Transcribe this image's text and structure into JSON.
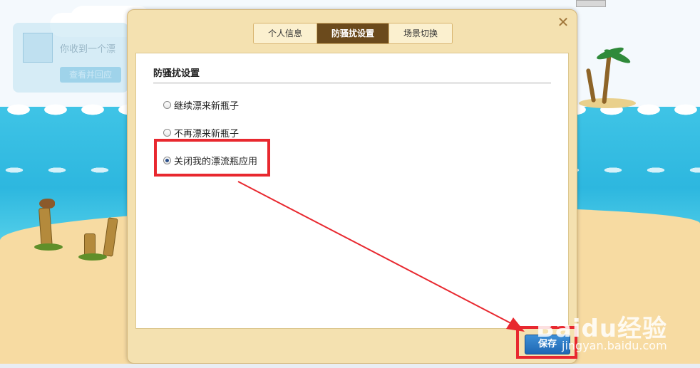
{
  "background": {
    "user_card": {
      "text": "你收到一个漂",
      "button_label": "查看并回应"
    }
  },
  "dialog": {
    "close_symbol": "✕",
    "tabs": [
      {
        "label": "个人信息",
        "active": false
      },
      {
        "label": "防骚扰设置",
        "active": true
      },
      {
        "label": "场景切换",
        "active": false
      }
    ],
    "section_title": "防骚扰设置",
    "options": [
      {
        "label": "继续漂来新瓶子",
        "checked": false
      },
      {
        "label": "不再漂来新瓶子",
        "checked": false
      },
      {
        "label": "关闭我的漂流瓶应用",
        "checked": true
      }
    ],
    "save_label": "保存"
  },
  "watermark": {
    "logo": "Baidu经验",
    "url": "jingyan.baidu.com"
  },
  "colors": {
    "accent": "#6b4a1c",
    "highlight": "#e8282f",
    "save_button": "#2a78c8"
  },
  "icons": [
    "close-icon",
    "radio-icon"
  ]
}
